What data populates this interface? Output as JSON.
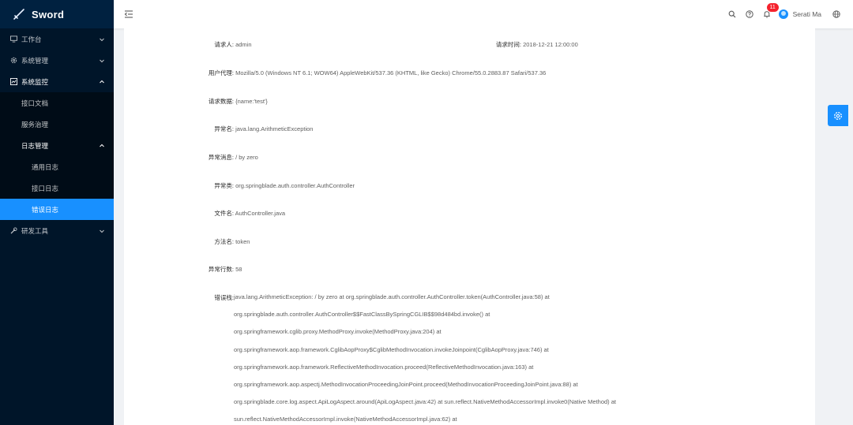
{
  "app": {
    "title": "Sword"
  },
  "colors": {
    "sidebar_bg": "#001529",
    "accent": "#1890ff",
    "badge": "#f5222d"
  },
  "sidebar": {
    "items": [
      {
        "label": "工作台",
        "icon": "desktop-icon"
      },
      {
        "label": "系统管理",
        "icon": "setting-icon"
      },
      {
        "label": "系统监控",
        "icon": "fund-icon"
      },
      {
        "label": "研发工具",
        "icon": "tool-icon"
      }
    ],
    "monitor_children": [
      {
        "label": "接口文档"
      },
      {
        "label": "服务治理"
      },
      {
        "label": "日志管理"
      }
    ],
    "log_children": [
      {
        "label": "通用日志"
      },
      {
        "label": "接口日志"
      },
      {
        "label": "错误日志"
      }
    ]
  },
  "header": {
    "notification_count": "11",
    "user_name": "Serati Ma"
  },
  "detail": {
    "requester_label": "请求人:",
    "requester_value": "admin",
    "request_time_label": "请求时间:",
    "request_time_value": "2018-12-21 12:00:00",
    "user_agent_label": "用户代理:",
    "user_agent_value": "Mozilla/5.0 (Windows NT 6.1; WOW64) AppleWebKit/537.36 (KHTML, like Gecko) Chrome/55.0.2883.87 Safari/537.36",
    "request_data_label": "请求数据:",
    "request_data_value": "{name:'test'}",
    "exception_name_label": "异常名:",
    "exception_name_value": "java.lang.ArithmeticException",
    "exception_message_label": "异常消息:",
    "exception_message_value": "/ by zero",
    "exception_class_label": "异常类:",
    "exception_class_value": "org.springblade.auth.controller.AuthController",
    "file_name_label": "文件名:",
    "file_name_value": "AuthController.java",
    "method_name_label": "方法名:",
    "method_name_value": "token",
    "exception_line_label": "异常行数:",
    "exception_line_value": "58",
    "stack_trace_label": "错误栈:",
    "stack_trace_lines": [
      "java.lang.ArithmeticException: / by zero at org.springblade.auth.controller.AuthController.token(AuthController.java:58) at",
      "org.springblade.auth.controller.AuthController$$FastClassBySpringCGLIB$$98d484bd.invoke() at",
      "org.springframework.cglib.proxy.MethodProxy.invoke(MethodProxy.java:204) at",
      "org.springframework.aop.framework.CglibAopProxy$CglibMethodInvocation.invokeJoinpoint(CglibAopProxy.java:746) at",
      "org.springframework.aop.framework.ReflectiveMethodInvocation.proceed(ReflectiveMethodInvocation.java:163) at",
      "org.springframework.aop.aspectj.MethodInvocationProceedingJoinPoint.proceed(MethodInvocationProceedingJoinPoint.java:88) at",
      "org.springblade.core.log.aspect.ApiLogAspect.around(ApiLogAspect.java:42) at sun.reflect.NativeMethodAccessorImpl.invoke0(Native Method) at",
      "sun.reflect.NativeMethodAccessorImpl.invoke(NativeMethodAccessorImpl.java:62) at"
    ]
  }
}
